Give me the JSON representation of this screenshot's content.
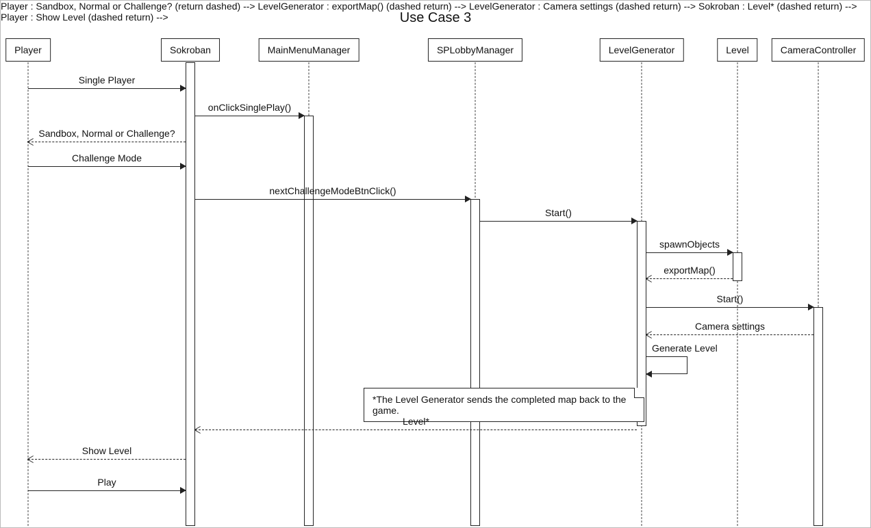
{
  "title": "Use Case 3",
  "participants": {
    "player": "Player",
    "sokroban": "Sokroban",
    "mainMenu": "MainMenuManager",
    "spLobby": "SPLobbyManager",
    "levelGen": "LevelGenerator",
    "level": "Level",
    "camera": "CameraController"
  },
  "messages": {
    "singlePlayer": "Single Player",
    "onClickSinglePlay": "onClickSinglePlay()",
    "sandboxQuestion": "Sandbox, Normal or Challenge?",
    "challengeMode": "Challenge Mode",
    "nextChallenge": "nextChallengeModeBtnClick()",
    "start1": "Start()",
    "spawnObjects": "spawnObjects",
    "exportMap": "exportMap()",
    "start2": "Start()",
    "cameraSettings": "Camera settings",
    "generateLevel": "Generate Level",
    "levelReturn": "Level*",
    "showLevel": "Show Level",
    "play": "Play"
  },
  "note": "*The Level Generator sends the completed map back to the game."
}
